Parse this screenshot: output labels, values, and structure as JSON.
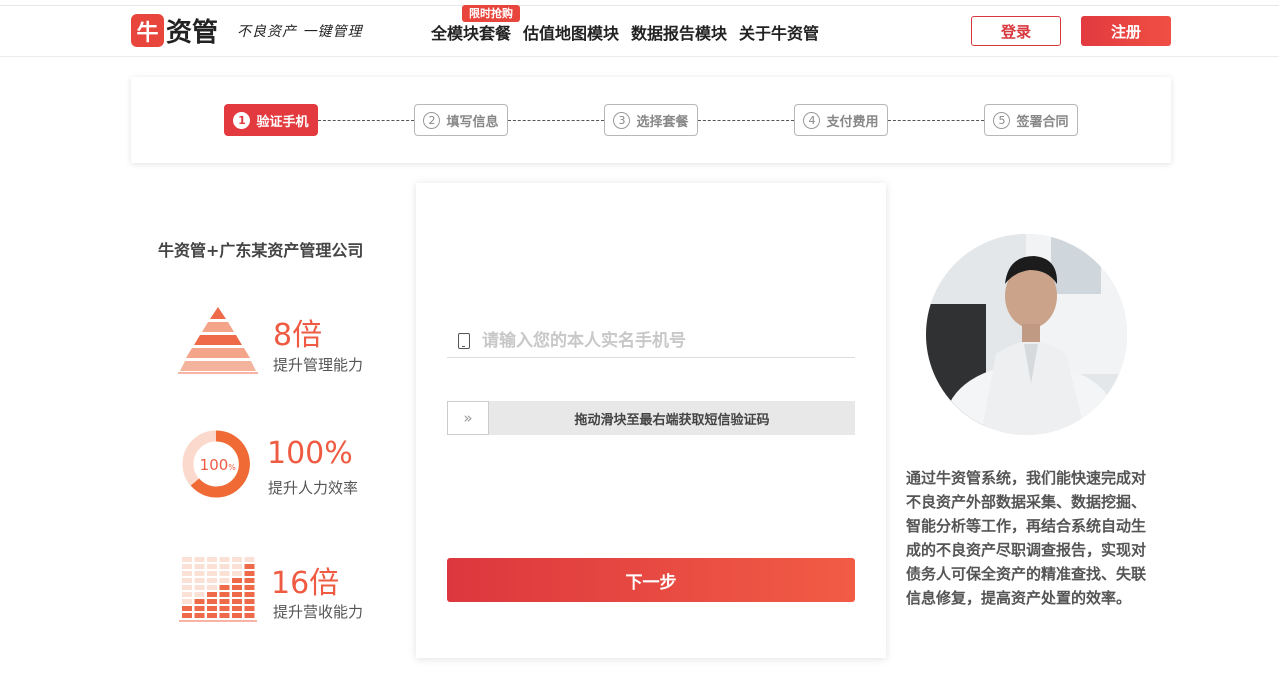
{
  "header": {
    "logo_mark": "牛",
    "logo_text": "资管",
    "slogan": "不良资产 一键管理",
    "nav": [
      "全模块套餐",
      "估值地图模块",
      "数据报告模块",
      "关于牛资管"
    ],
    "hot_badge": "限时抢购",
    "login_label": "登录",
    "register_label": "注册"
  },
  "steps": [
    {
      "num": "1",
      "label": "验证手机",
      "active": true
    },
    {
      "num": "2",
      "label": "填写信息",
      "active": false
    },
    {
      "num": "3",
      "label": "选择套餐",
      "active": false
    },
    {
      "num": "4",
      "label": "支付费用",
      "active": false
    },
    {
      "num": "5",
      "label": "签署合同",
      "active": false
    }
  ],
  "left": {
    "company": "牛资管+广东某资产管理公司",
    "stats": [
      {
        "value": "8倍",
        "label": "提升管理能力",
        "icon": "pyramid-icon"
      },
      {
        "value": "100%",
        "label": "提升人力效率",
        "icon": "ring-icon",
        "ring_text": "100",
        "ring_unit": "%"
      },
      {
        "value": "16倍",
        "label": "提升营收能力",
        "icon": "bar-chart-icon"
      }
    ]
  },
  "form": {
    "phone_placeholder": "请输入您的本人实名手机号",
    "phone_value": "",
    "slider_handle": "»",
    "slider_text": "拖动滑块至最右端获取短信验证码",
    "next_label": "下一步"
  },
  "right": {
    "description": "通过牛资管系统，我们能快速完成对不良资产外部数据采集、数据挖掘、智能分析等工作，再结合系统自动生成的不良资产尽职调查报告，实现对债务人可保全资产的精准查找、失联信息修复，提高资产处置的效率。"
  },
  "colors": {
    "accent": "#e23a3f",
    "stat": "#ef5b42",
    "stat_light": "#f8c7b5"
  }
}
